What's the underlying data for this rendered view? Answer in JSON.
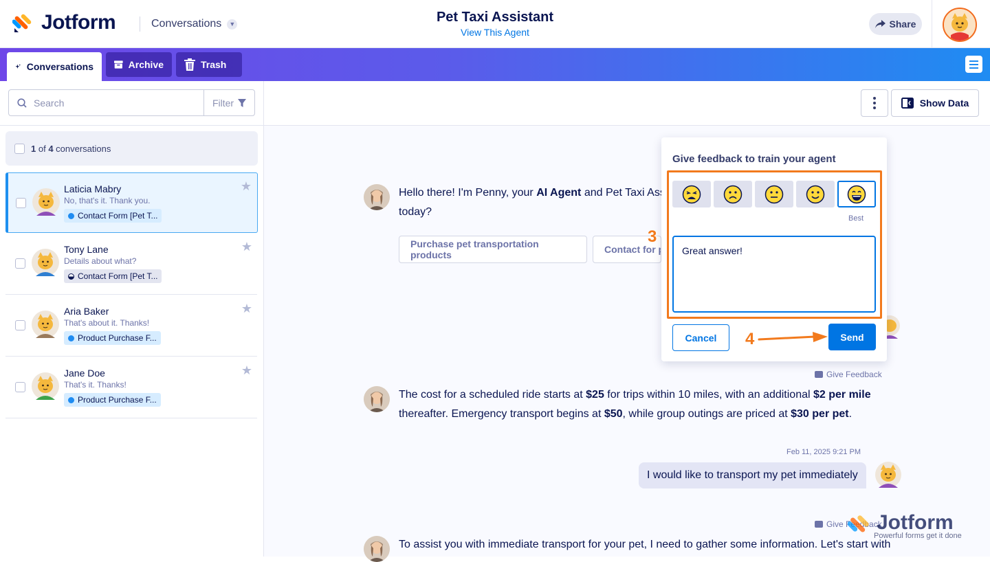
{
  "header": {
    "brand": "Jotform",
    "section_dropdown": "Conversations",
    "agent_title": "Pet Taxi Assistant",
    "agent_link": "View This Agent",
    "share_label": "Share"
  },
  "tabs": [
    {
      "label": "Conversations",
      "active": true
    },
    {
      "label": "Archive",
      "active": false
    },
    {
      "label": "Trash",
      "active": false
    }
  ],
  "sidebar": {
    "search_placeholder": "Search",
    "filter_label": "Filter",
    "count_num": "1",
    "count_of": " of ",
    "count_total": "4",
    "count_suffix": " conversations",
    "conversations": [
      {
        "name": "Laticia Mabry",
        "message": "No, that's it. Thank you.",
        "tag": "Contact Form [Pet T...",
        "selected": true
      },
      {
        "name": "Tony Lane",
        "message": "Details about what?",
        "tag": "Contact Form [Pet T...",
        "selected": false
      },
      {
        "name": "Aria Baker",
        "message": "That's about it. Thanks!",
        "tag": "Product Purchase F...",
        "selected": false
      },
      {
        "name": "Jane Doe",
        "message": "That's it. Thanks!",
        "tag": "Product Purchase F...",
        "selected": false
      }
    ]
  },
  "toolbar": {
    "show_data_label": "Show Data"
  },
  "chat": {
    "greeting_pre": "Hello there! I'm Penny, your ",
    "greeting_bold": "AI Agent",
    "greeting_post": " and Pet Taxi Assis",
    "greeting_line2": "today?",
    "chips": [
      "Purchase pet transportation products",
      "Contact for p"
    ],
    "give_feedback": "Give Feedback",
    "price_1": "The cost for a scheduled ride starts at ",
    "price_b1": "$25",
    "price_2": " for trips within 10 miles, with an additional ",
    "price_b2": "$2 per mile",
    "price_3": "thereafter. Emergency transport begins at ",
    "price_b3": "$50",
    "price_4": ", while group outings are priced at ",
    "price_b4": "$30 per pet",
    "price_5": ".",
    "timestamp": "Feb 11, 2025 9:21 PM",
    "user_message": "I would like to transport my pet immediately",
    "last_message": "To assist you with immediate transport for your pet, I need to gather some information. Let's start with"
  },
  "feedback_popup": {
    "title": "Give feedback to train your agent",
    "emojis": [
      "very-bad",
      "bad",
      "neutral",
      "good",
      "best"
    ],
    "selected_emoji": "best",
    "best_label": "Best",
    "text_value": "Great answer!",
    "cancel_label": "Cancel",
    "send_label": "Send"
  },
  "annotations": {
    "step3": "3",
    "step4": "4",
    "highlight_color": "#f27a1d"
  },
  "watermark": {
    "brand": "Jotform",
    "tagline": "Powerful forms get it done"
  },
  "colors": {
    "primary_blue": "#0075e3",
    "navy": "#0a1551",
    "accent_orange": "#f27a1d"
  }
}
